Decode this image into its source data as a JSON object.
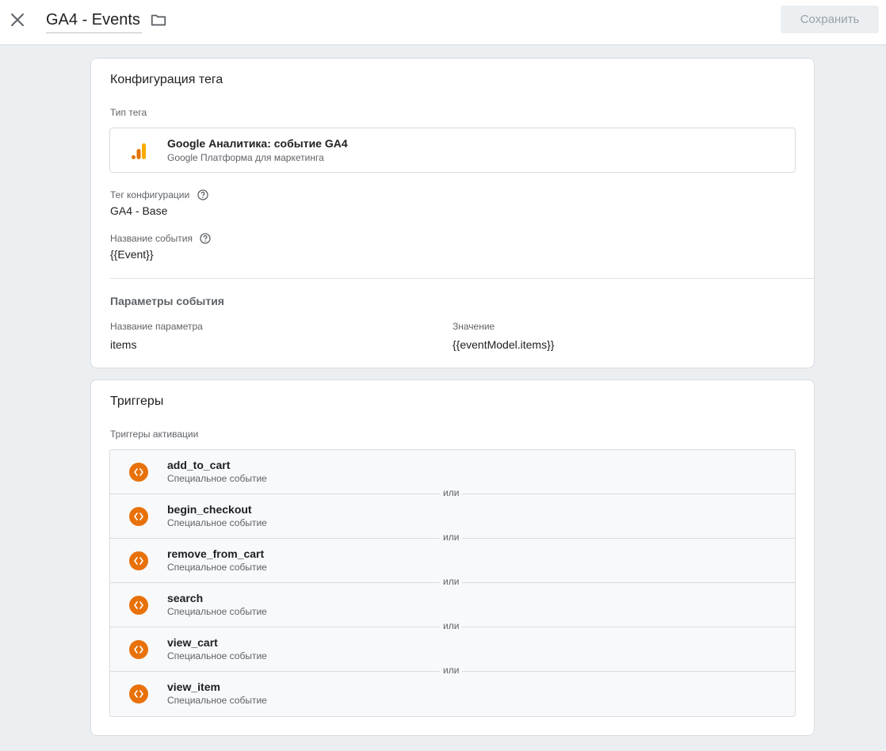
{
  "header": {
    "title": "GA4 - Events",
    "save_label": "Сохранить"
  },
  "tag_config": {
    "title": "Конфигурация тега",
    "tag_type_label": "Тип тега",
    "tag_type_name": "Google Аналитика: событие GA4",
    "tag_type_sub": "Google Платформа для маркетинга",
    "config_tag_label": "Тег конфигурации",
    "config_tag_value": "GA4 - Base",
    "event_name_label": "Название события",
    "event_name_value": "{{Event}}",
    "params_title": "Параметры события",
    "param_name_header": "Название параметра",
    "param_value_header": "Значение",
    "params": [
      {
        "name": "items",
        "value": "{{eventModel.items}}"
      }
    ]
  },
  "triggers": {
    "title": "Триггеры",
    "firing_label": "Триггеры активации",
    "or_label": "или",
    "items": [
      {
        "name": "add_to_cart",
        "type": "Специальное событие"
      },
      {
        "name": "begin_checkout",
        "type": "Специальное событие"
      },
      {
        "name": "remove_from_cart",
        "type": "Специальное событие"
      },
      {
        "name": "search",
        "type": "Специальное событие"
      },
      {
        "name": "view_cart",
        "type": "Специальное событие"
      },
      {
        "name": "view_item",
        "type": "Специальное событие"
      }
    ]
  },
  "colors": {
    "accent_orange": "#e8710a",
    "analytics_yellow": "#f9ab00",
    "analytics_orange": "#e37400"
  },
  "icons": [
    "close-icon",
    "folder-icon",
    "help-icon",
    "analytics-icon",
    "custom-event-icon"
  ]
}
